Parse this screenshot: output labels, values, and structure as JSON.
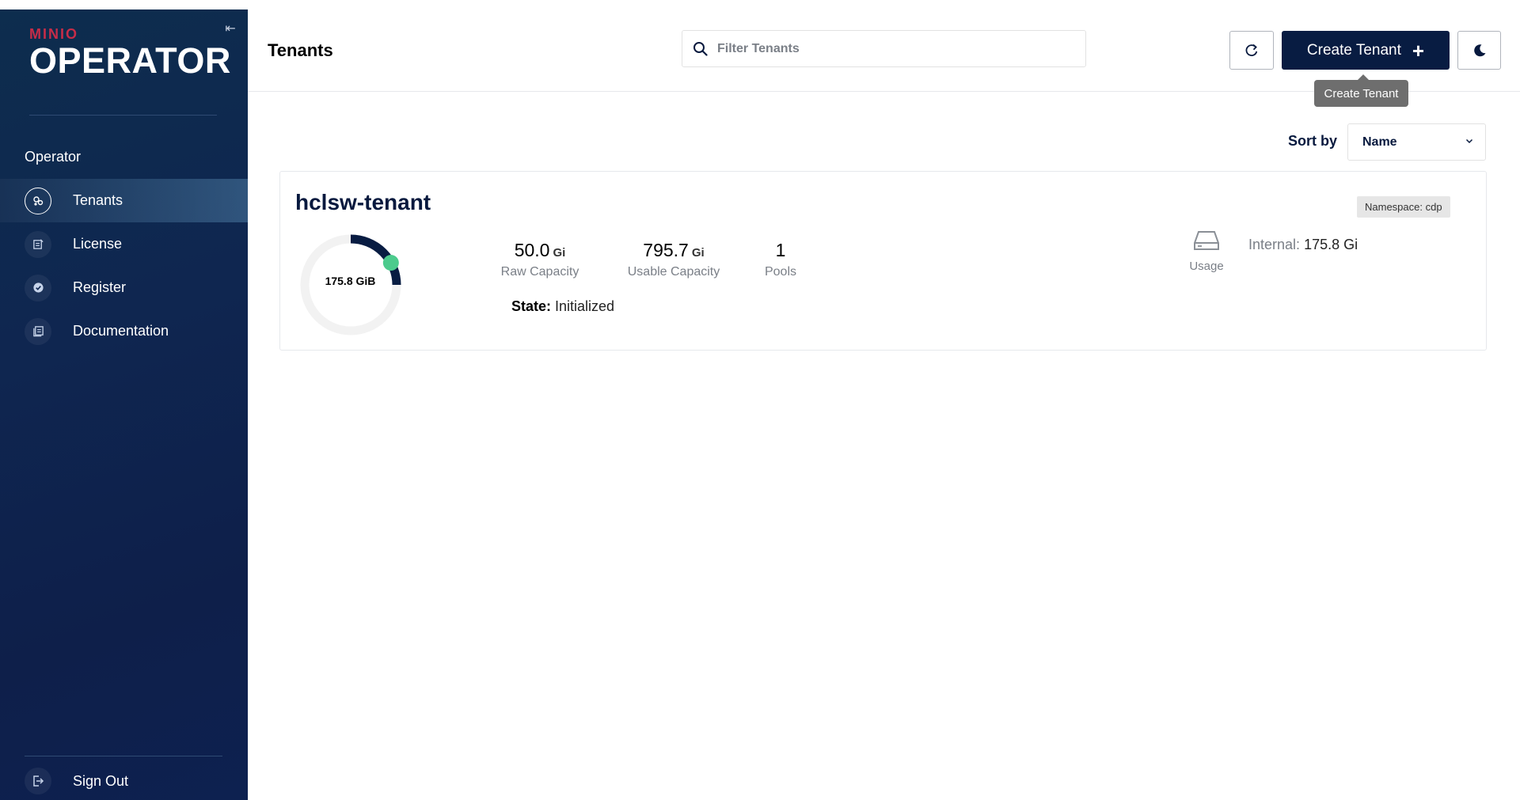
{
  "brand": {
    "top": "MINIO",
    "name": "OPERATOR"
  },
  "sidebar": {
    "section": "Operator",
    "items": [
      {
        "label": "Tenants",
        "icon": "tenants-icon",
        "active": true
      },
      {
        "label": "License",
        "icon": "license-icon",
        "active": false
      },
      {
        "label": "Register",
        "icon": "register-icon",
        "active": false
      },
      {
        "label": "Documentation",
        "icon": "documentation-icon",
        "active": false
      }
    ],
    "signout": "Sign Out"
  },
  "header": {
    "title": "Tenants",
    "search_placeholder": "Filter Tenants",
    "create_label": "Create Tenant",
    "tooltip": "Create Tenant"
  },
  "sort": {
    "label": "Sort by",
    "value": "Name"
  },
  "tenant": {
    "name": "hclsw-tenant",
    "namespace": "Namespace: cdp",
    "usage_total": "175.8 GiB",
    "usage_fraction": 0.25,
    "raw_capacity": {
      "value": "50.0",
      "unit": "Gi",
      "label": "Raw Capacity"
    },
    "usable_capacity": {
      "value": "795.7",
      "unit": "Gi",
      "label": "Usable Capacity"
    },
    "pools": {
      "value": "1",
      "label": "Pools"
    },
    "state_key": "State:",
    "state_value": "Initialized",
    "usage_label": "Usage",
    "internal_key": "Internal:",
    "internal_value": "175.8 Gi"
  },
  "colors": {
    "sidebar": "#0f2650",
    "primary": "#081c42",
    "health": "#4ccb8d",
    "ring": "#f2f2f2"
  }
}
